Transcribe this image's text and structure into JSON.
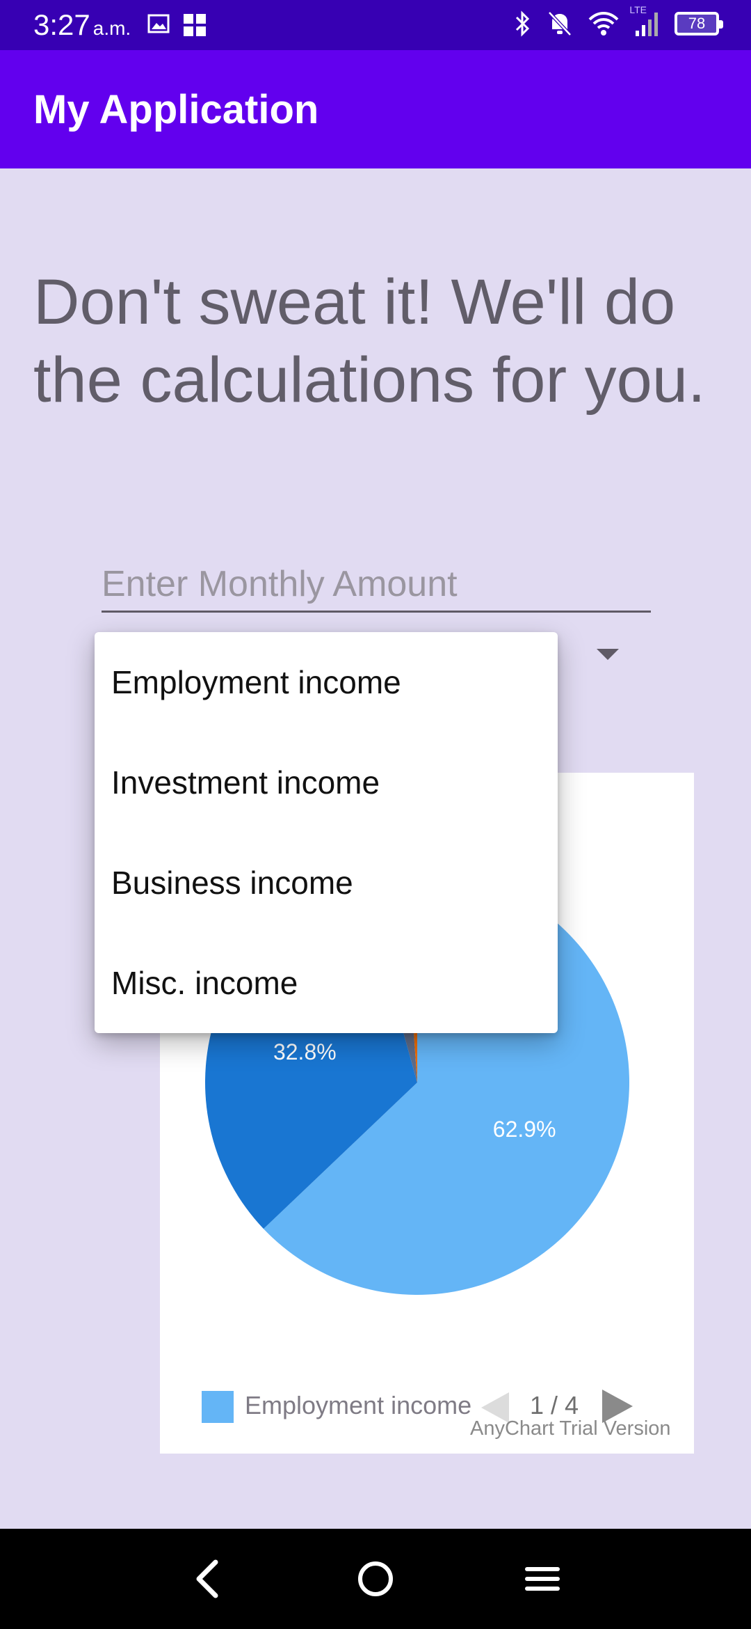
{
  "status_bar": {
    "time": "3:27",
    "ampm": "a.m.",
    "network": "LTE",
    "battery": "78",
    "icons": [
      "image-icon",
      "grid-icon",
      "bluetooth-icon",
      "mute-icon",
      "wifi-icon",
      "signal-icon",
      "battery-icon"
    ]
  },
  "app_bar": {
    "title": "My Application"
  },
  "headline": "Don't sweat it! We'll do the calculations for you.",
  "amount_input": {
    "placeholder": "Enter Monthly Amount",
    "value": ""
  },
  "dropdown": {
    "options": [
      "Employment income",
      "Investment income",
      "Business income",
      "Misc. income"
    ]
  },
  "chart_data": {
    "type": "pie",
    "slices": [
      {
        "label": "Employment income",
        "value": 62.9,
        "color": "#64b5f6"
      },
      {
        "label": "",
        "value": 32.8,
        "color": "#1976d2"
      },
      {
        "label": "",
        "value": 3.2,
        "color": "#5f6d8a"
      },
      {
        "label": "",
        "value": 1.1,
        "color": "#ef6c00"
      }
    ],
    "data_labels": [
      "62.9%",
      "32.8%"
    ],
    "legend": {
      "visible_item": "Employment income",
      "page": "1 / 4",
      "placement": "bottom"
    },
    "credit": "AnyChart Trial Version"
  },
  "colors": {
    "app_bar": "#6200ee",
    "status_bar": "#3700b3",
    "background": "#e1dbf2"
  },
  "nav_bar": {
    "icons": [
      "back-icon",
      "home-icon",
      "menu-icon"
    ]
  }
}
